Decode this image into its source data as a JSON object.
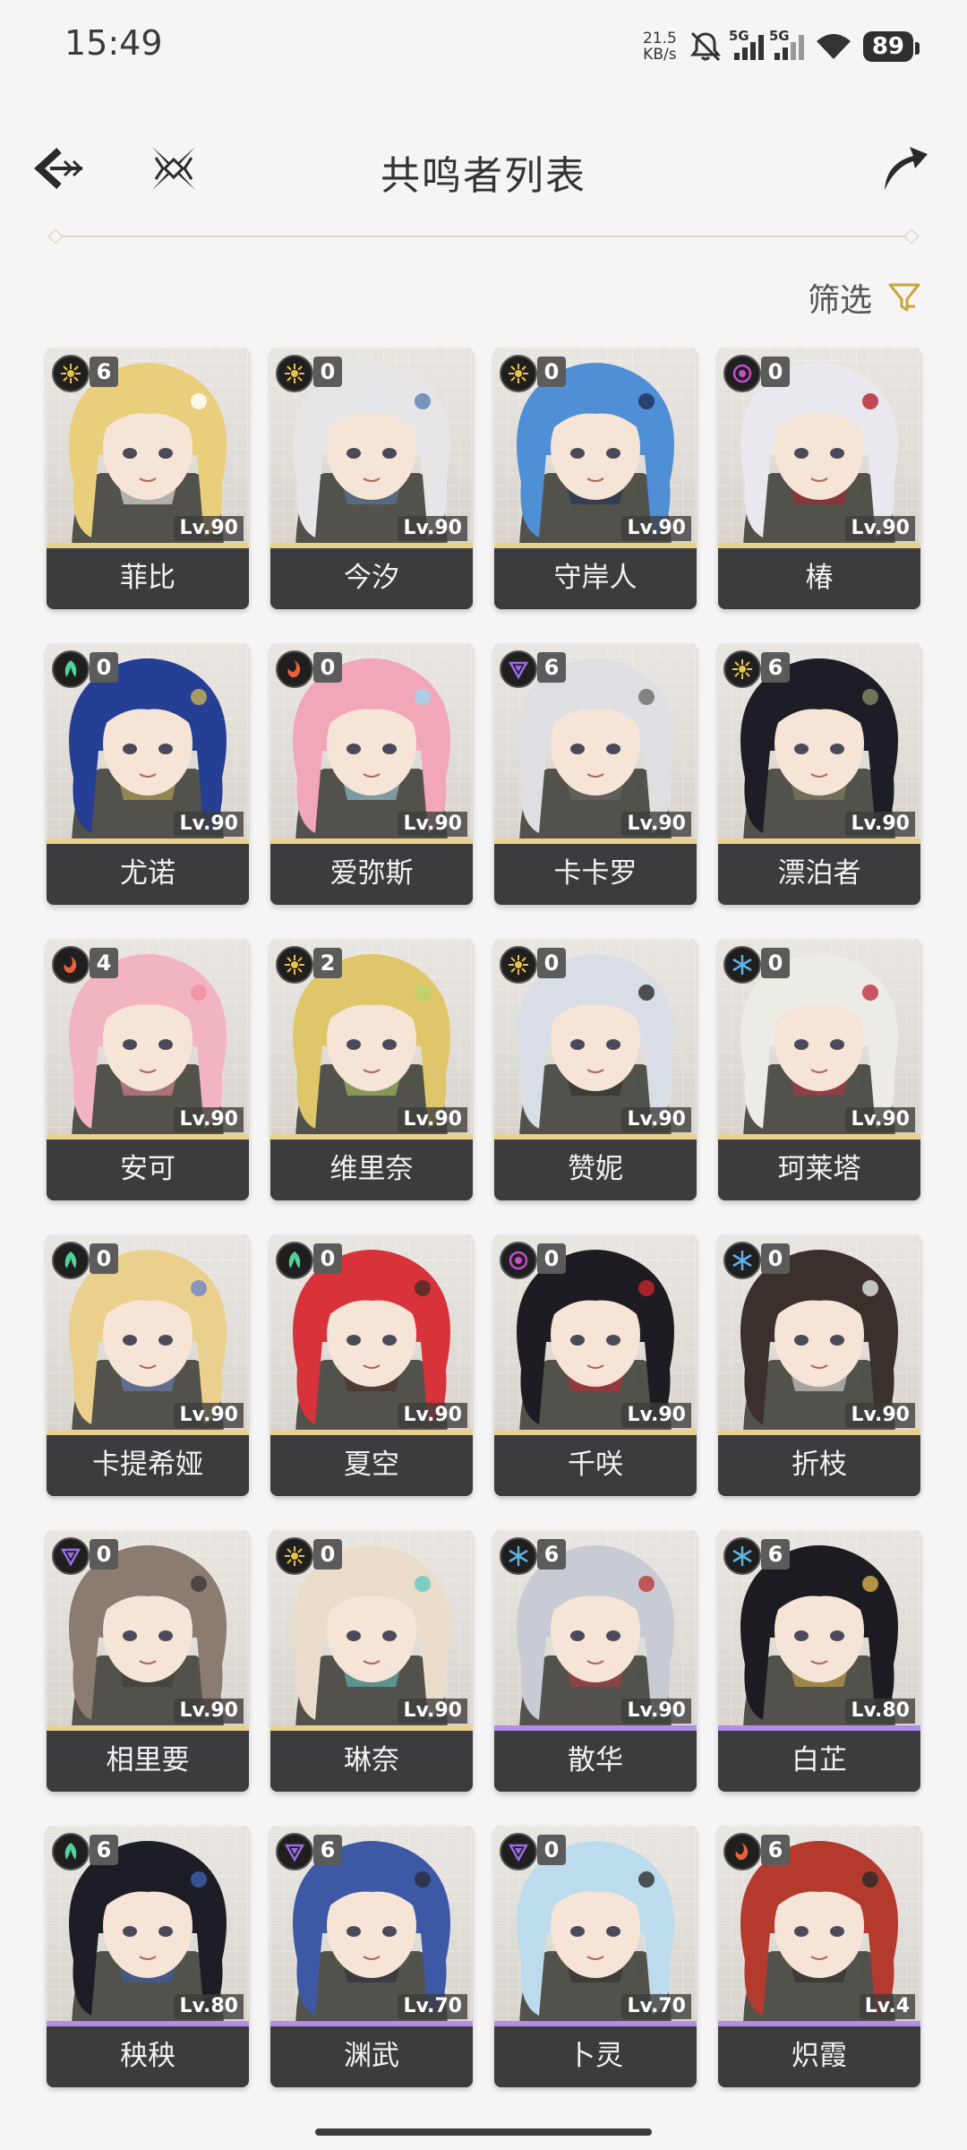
{
  "status_bar": {
    "time": "15:49",
    "net_speed_value": "21.5",
    "net_speed_unit": "KB/s",
    "signal1_label": "5G",
    "signal2_label": "5G",
    "battery": "89"
  },
  "header": {
    "title": "共鸣者列表"
  },
  "filter_label": "筛选",
  "colors": {
    "spectro": "#e8c24a",
    "glacio": "#5fb2e8",
    "aero": "#4fd59a",
    "fusion": "#e8613a",
    "havoc": "#c84bd0",
    "electro": "#9b6be8",
    "five_star": "#e9d28c",
    "four_star": "#b58ce8"
  },
  "characters": [
    {
      "name": "菲比",
      "level": "Lv.90",
      "cons": "6",
      "element": "spectro",
      "rarity": 5,
      "hair": "#e9cf7c",
      "accent": "#ffffff"
    },
    {
      "name": "今汐",
      "level": "Lv.90",
      "cons": "0",
      "element": "spectro",
      "rarity": 5,
      "hair": "#e6e6e8",
      "accent": "#5a7fb0"
    },
    {
      "name": "守岸人",
      "level": "Lv.90",
      "cons": "0",
      "element": "spectro",
      "rarity": 5,
      "hair": "#4f8fd6",
      "accent": "#1c2f5a"
    },
    {
      "name": "椿",
      "level": "Lv.90",
      "cons": "0",
      "element": "havoc",
      "rarity": 5,
      "hair": "#e8e8ee",
      "accent": "#b2202a"
    },
    {
      "name": "尤诺",
      "level": "Lv.90",
      "cons": "0",
      "element": "aero",
      "rarity": 5,
      "hair": "#243f93",
      "accent": "#c9b25d"
    },
    {
      "name": "爱弥斯",
      "level": "Lv.90",
      "cons": "0",
      "element": "fusion",
      "rarity": 5,
      "hair": "#f1a7b8",
      "accent": "#9fd8ee"
    },
    {
      "name": "卡卡罗",
      "level": "Lv.90",
      "cons": "6",
      "element": "electro",
      "rarity": 5,
      "hair": "#dedfe3",
      "accent": "#6b6b6b"
    },
    {
      "name": "漂泊者",
      "level": "Lv.90",
      "cons": "6",
      "element": "spectro",
      "rarity": 5,
      "hair": "#1d1d25",
      "accent": "#8a8a62"
    },
    {
      "name": "安可",
      "level": "Lv.90",
      "cons": "4",
      "element": "fusion",
      "rarity": 5,
      "hair": "#f2b4c1",
      "accent": "#ee8fa2"
    },
    {
      "name": "维里奈",
      "level": "Lv.90",
      "cons": "2",
      "element": "spectro",
      "rarity": 5,
      "hair": "#e0c66a",
      "accent": "#b5d36a"
    },
    {
      "name": "赞妮",
      "level": "Lv.90",
      "cons": "0",
      "element": "spectro",
      "rarity": 5,
      "hair": "#d9dde6",
      "accent": "#2a2a2a"
    },
    {
      "name": "珂莱塔",
      "level": "Lv.90",
      "cons": "0",
      "element": "glacio",
      "rarity": 5,
      "hair": "#ecebe6",
      "accent": "#c1303f"
    },
    {
      "name": "卡提希娅",
      "level": "Lv.90",
      "cons": "0",
      "element": "aero",
      "rarity": 5,
      "hair": "#ead08c",
      "accent": "#6e86c8"
    },
    {
      "name": "夏空",
      "level": "Lv.90",
      "cons": "0",
      "element": "aero",
      "rarity": 5,
      "hair": "#d8323a",
      "accent": "#4a2a24"
    },
    {
      "name": "千咲",
      "level": "Lv.90",
      "cons": "0",
      "element": "havoc",
      "rarity": 5,
      "hair": "#1c1c22",
      "accent": "#c9252f"
    },
    {
      "name": "折枝",
      "level": "Lv.90",
      "cons": "0",
      "element": "glacio",
      "rarity": 5,
      "hair": "#3a302c",
      "accent": "#e9e9e9"
    },
    {
      "name": "相里要",
      "level": "Lv.90",
      "cons": "0",
      "element": "electro",
      "rarity": 5,
      "hair": "#8c7b70",
      "accent": "#3e3a35"
    },
    {
      "name": "琳奈",
      "level": "Lv.90",
      "cons": "0",
      "element": "spectro",
      "rarity": 5,
      "hair": "#eadcc8",
      "accent": "#62c9c5"
    },
    {
      "name": "散华",
      "level": "Lv.90",
      "cons": "6",
      "element": "glacio",
      "rarity": 4,
      "hair": "#c9cbd4",
      "accent": "#b93a3a"
    },
    {
      "name": "白芷",
      "level": "Lv.80",
      "cons": "6",
      "element": "glacio",
      "rarity": 4,
      "hair": "#1b1b21",
      "accent": "#d8b24a"
    },
    {
      "name": "秧秧",
      "level": "Lv.80",
      "cons": "6",
      "element": "aero",
      "rarity": 4,
      "hair": "#1d1d26",
      "accent": "#3d5fb0"
    },
    {
      "name": "渊武",
      "level": "Lv.70",
      "cons": "6",
      "element": "electro",
      "rarity": 4,
      "hair": "#3d59a6",
      "accent": "#2a2a3c"
    },
    {
      "name": "卜灵",
      "level": "Lv.70",
      "cons": "0",
      "element": "electro",
      "rarity": 4,
      "hair": "#bcdcee",
      "accent": "#2c2c2c"
    },
    {
      "name": "炽霞",
      "level": "Lv.4",
      "cons": "6",
      "element": "fusion",
      "rarity": 4,
      "hair": "#b53a2e",
      "accent": "#2a2a2a"
    }
  ]
}
